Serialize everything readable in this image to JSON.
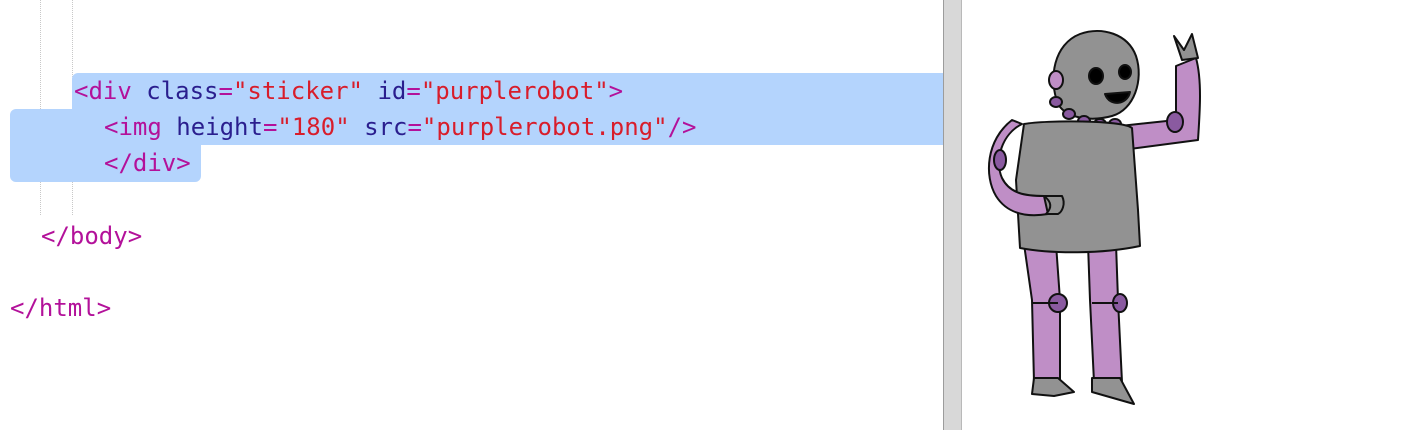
{
  "editor": {
    "lines": [
      {
        "indent": "  ",
        "parts": [
          {
            "t": "tag",
            "v": "<div "
          },
          {
            "t": "attr",
            "v": "class"
          },
          {
            "t": "eq",
            "v": "="
          },
          {
            "t": "str",
            "v": "\"sticker\""
          },
          {
            "t": "plain",
            "v": " "
          },
          {
            "t": "attr",
            "v": "id"
          },
          {
            "t": "eq",
            "v": "="
          },
          {
            "t": "str",
            "v": "\"purplerobot\""
          },
          {
            "t": "tag",
            "v": ">"
          }
        ]
      },
      {
        "indent": "    ",
        "parts": [
          {
            "t": "tag",
            "v": "<img "
          },
          {
            "t": "attr",
            "v": "height"
          },
          {
            "t": "eq",
            "v": "="
          },
          {
            "t": "str",
            "v": "\"180\""
          },
          {
            "t": "plain",
            "v": " "
          },
          {
            "t": "attr",
            "v": "src"
          },
          {
            "t": "eq",
            "v": "="
          },
          {
            "t": "str",
            "v": "\"purplerobot.png\""
          },
          {
            "t": "tag",
            "v": "/>"
          }
        ]
      },
      {
        "indent": "    ",
        "parts": [
          {
            "t": "tag",
            "v": "</div>"
          }
        ]
      },
      {
        "indent": "",
        "parts": []
      },
      {
        "indent": " ",
        "parts": [
          {
            "t": "tag",
            "v": "</body>"
          }
        ]
      },
      {
        "indent": "",
        "parts": []
      },
      {
        "indent": "",
        "parts": [
          {
            "t": "tag",
            "v": "</html>"
          }
        ]
      }
    ]
  },
  "colors": {
    "tag": "#b3119a",
    "attribute": "#2a1e8e",
    "string": "#d81d2b",
    "selection": "#b4d4fd",
    "robot_body": "#929292",
    "robot_limbs": "#bf8ec6",
    "robot_joints": "#8a5aa0"
  },
  "preview": {
    "image_icon": "purple-robot-sticker"
  }
}
